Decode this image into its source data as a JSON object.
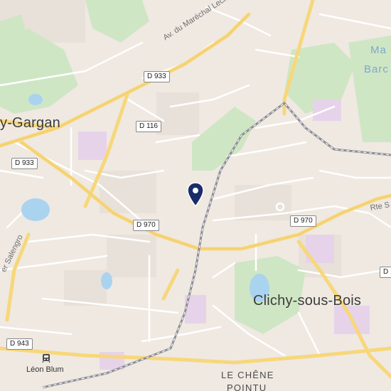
{
  "map": {
    "places": [
      {
        "id": "gargan",
        "text": "y-Gargan"
      },
      {
        "id": "clichy",
        "text": "Clichy-sous-Bois"
      },
      {
        "id": "chene1",
        "text": "LE CHÊNE"
      },
      {
        "id": "chene2",
        "text": "POINTU"
      },
      {
        "id": "mare1",
        "text": "Ma"
      },
      {
        "id": "mare2",
        "text": "Barc"
      }
    ],
    "streets": [
      {
        "id": "marechal",
        "text": "Av. du Maréchal Leclerc"
      },
      {
        "id": "rte",
        "text": "Rte S"
      },
      {
        "id": "salengro",
        "text": "er Salengro"
      }
    ],
    "road_shields": [
      {
        "id": "d933a",
        "text": "D 933"
      },
      {
        "id": "d116",
        "text": "D 116"
      },
      {
        "id": "d933b",
        "text": "D 933"
      },
      {
        "id": "d970a",
        "text": "D 970"
      },
      {
        "id": "d970b",
        "text": "D 970"
      },
      {
        "id": "d943",
        "text": "D 943"
      },
      {
        "id": "d1",
        "text": "D 1"
      }
    ],
    "transit": {
      "station": "Léon Blum",
      "icon": "tram-icon"
    },
    "marker": {
      "icon": "location-pin-icon",
      "color": "#1a2d6b"
    },
    "colors": {
      "land": "#efe9e2",
      "park": "#cfe6c4",
      "water": "#aad3f0",
      "major_road": "#f7d77a",
      "minor_road": "#ffffff",
      "rail": "#8d8d96",
      "campus": "#e6d3ea"
    }
  }
}
